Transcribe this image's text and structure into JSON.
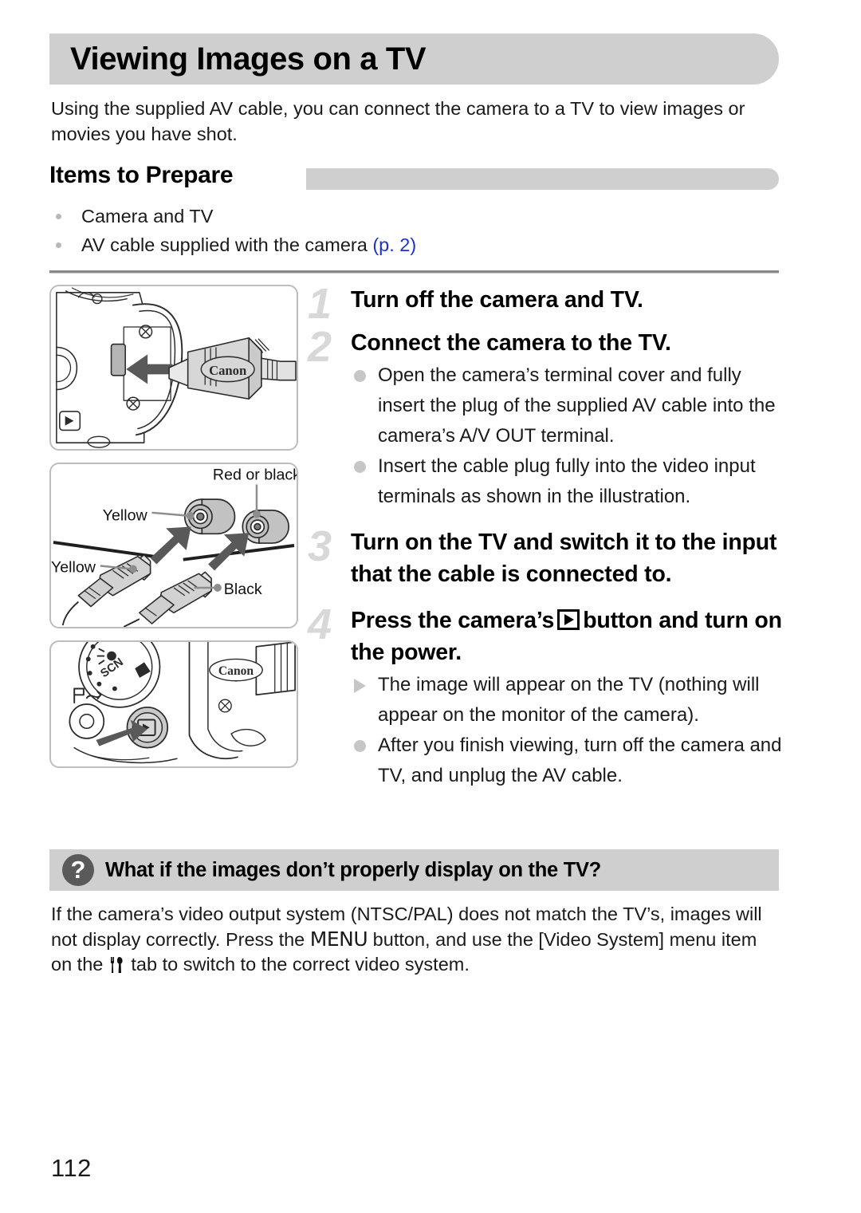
{
  "page": {
    "title": "Viewing Images on a TV",
    "intro": "Using the supplied AV cable, you can connect the camera to a TV to view images or movies you have shot.",
    "page_number": "112"
  },
  "items_to_prepare": {
    "heading": "Items to Prepare",
    "items": [
      {
        "text": "Camera and TV",
        "page_ref": ""
      },
      {
        "text": "AV cable supplied with the camera ",
        "page_ref": "(p. 2)"
      }
    ]
  },
  "steps": [
    {
      "number": "1",
      "title": "Turn off the camera and TV.",
      "subs": []
    },
    {
      "number": "2",
      "title": "Connect the camera to the TV.",
      "subs": [
        {
          "marker": "circle",
          "text": "Open the camera’s terminal cover and fully insert the plug of the supplied AV cable into the camera’s A/V OUT terminal."
        },
        {
          "marker": "circle",
          "text": "Insert the cable plug fully into the video input terminals as shown in the illustration."
        }
      ]
    },
    {
      "number": "3",
      "title": "Turn on the TV and switch it to the input that the cable is connected to.",
      "subs": []
    },
    {
      "number": "4",
      "title_before": "Press the camera’s",
      "title_after": "button and turn on the power.",
      "number_label": "4",
      "subs": [
        {
          "marker": "triangle",
          "text": "The image will appear on the TV (nothing will appear on the monitor of the camera)."
        },
        {
          "marker": "circle",
          "text": "After you finish viewing, turn off the camera and TV, and unplug the AV cable."
        }
      ]
    }
  ],
  "figures": {
    "fig1": {
      "caption": "Canon AV cable inserted into camera A/V OUT terminal",
      "brand_label": "Canon"
    },
    "fig2": {
      "caption": "RCA plugs into TV video input terminals",
      "labels": {
        "red_or_black": "Red or black",
        "yellow_jack": "Yellow",
        "yellow_plug": "Yellow",
        "black_plug": "Black"
      }
    },
    "fig3": {
      "caption": "Pressing the camera playback button",
      "brand_label": "Canon",
      "dial_labels": [
        "SCN"
      ]
    }
  },
  "qa": {
    "icon": "question-mark",
    "title": "What if the images don’t properly display on the TV?",
    "body_part1": "If the camera’s video output system (NTSC/PAL) does not match the TV’s, images will not display correctly. Press the ",
    "menu_label": "MENU",
    "body_part2": " button, and use the [Video System] menu item on the ",
    "body_part3": " tab to switch to the correct video system."
  },
  "colors": {
    "bar_gray": "#cfcfcf",
    "bullet_gray": "#c6c6c6",
    "step_number_gray": "#d8d8d8",
    "link_blue": "#1c31d4",
    "qa_icon_gray": "#5a5a5a"
  }
}
